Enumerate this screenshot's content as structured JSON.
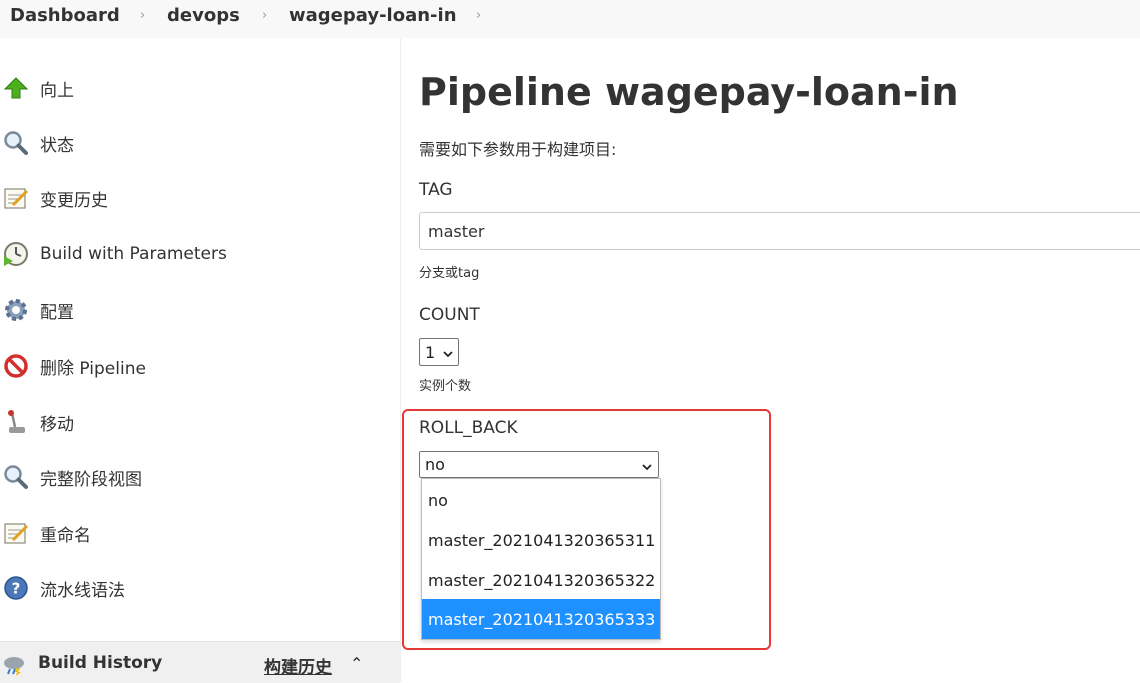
{
  "breadcrumb": {
    "items": [
      "Dashboard",
      "devops",
      "wagepay-loan-in"
    ],
    "separator": "›"
  },
  "sidebar": {
    "items": [
      {
        "label": "向上",
        "icon": "up-arrow-icon"
      },
      {
        "label": "状态",
        "icon": "magnifier-icon"
      },
      {
        "label": "变更历史",
        "icon": "notepad-icon"
      },
      {
        "label": "Build with Parameters",
        "icon": "clock-play-icon"
      },
      {
        "label": "配置",
        "icon": "gear-icon"
      },
      {
        "label": "删除 Pipeline",
        "icon": "no-entry-icon"
      },
      {
        "label": "移动",
        "icon": "joystick-icon"
      },
      {
        "label": "完整阶段视图",
        "icon": "magnifier-icon"
      },
      {
        "label": "重命名",
        "icon": "notepad-icon"
      },
      {
        "label": "流水线语法",
        "icon": "help-icon"
      }
    ],
    "build_history": {
      "title": "Build History",
      "link": "构建历史",
      "toggle": "⌃",
      "icon": "weather-icon"
    }
  },
  "main": {
    "title": "Pipeline wagepay-loan-in",
    "intro": "需要如下参数用于构建项目:",
    "params": {
      "tag": {
        "name": "TAG",
        "value": "master",
        "help": "分支或tag"
      },
      "count": {
        "name": "COUNT",
        "value": "1",
        "help": "实例个数"
      },
      "roll_back": {
        "name": "ROLL_BACK",
        "value": "no",
        "options": [
          "no",
          "master_2021041320365311",
          "master_2021041320365322",
          "master_2021041320365333"
        ],
        "highlighted_option": "master_2021041320365333"
      }
    }
  },
  "colors": {
    "highlight_border": "#e53935",
    "selected_option": "#1e90ff",
    "breadcrumb_bg": "#f8f8f8",
    "build_history_bg": "#f0f0f0"
  }
}
